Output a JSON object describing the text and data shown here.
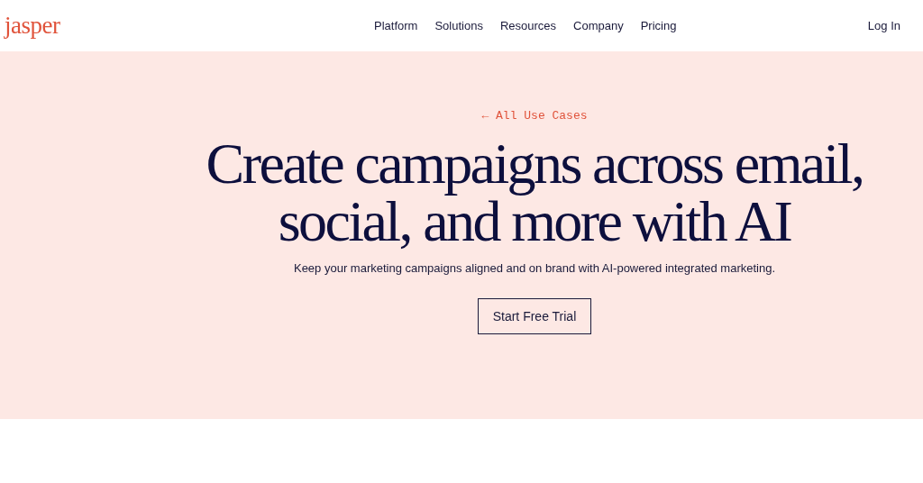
{
  "header": {
    "logo": "jasper",
    "nav": [
      "Platform",
      "Solutions",
      "Resources",
      "Company",
      "Pricing"
    ],
    "login": "Log In"
  },
  "hero": {
    "back_link": "← All Use Cases",
    "headline_lines": [
      "Create campaigns across email,",
      "social, and more with AI"
    ],
    "subtitle": "Keep your marketing campaigns aligned and on brand with AI-powered integrated marketing.",
    "cta": "Start Free Trial"
  }
}
